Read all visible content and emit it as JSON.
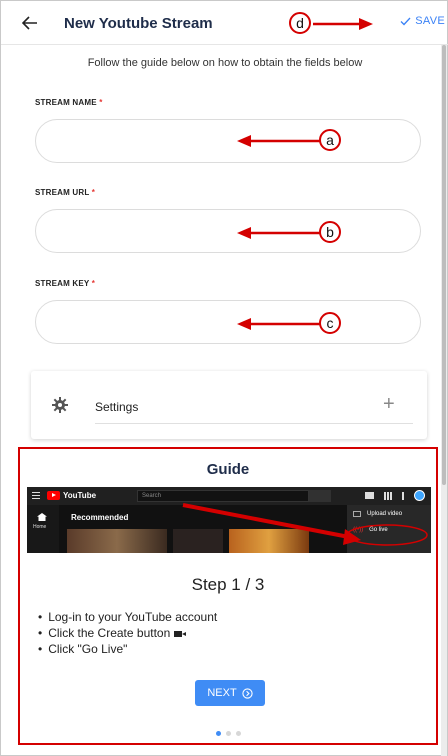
{
  "header": {
    "title": "New Youtube Stream",
    "save_label": "SAVE"
  },
  "intro": "Follow the guide below on how to obtain the fields below",
  "fields": [
    {
      "label": "STREAM NAME",
      "required_mark": "*",
      "value": "",
      "annotation": "a"
    },
    {
      "label": "STREAM URL",
      "required_mark": "*",
      "value": "",
      "annotation": "b"
    },
    {
      "label": "STREAM KEY",
      "required_mark": "*",
      "value": "",
      "annotation": "c"
    }
  ],
  "save_annotation": "d",
  "settings": {
    "label": "Settings",
    "expand_symbol": "+"
  },
  "guide": {
    "title": "Guide",
    "screenshot": {
      "search_placeholder": "Search",
      "logo_text": "YouTube",
      "home_label": "Home",
      "recommended": "Recommended",
      "menu_upload": "Upload video",
      "menu_go_live": "Go live"
    },
    "step": "Step 1 / 3",
    "bullets": [
      "Log-in to your YouTube account",
      "Click the Create button",
      "Click \"Go Live\""
    ],
    "next_label": "NEXT",
    "pager": {
      "current": 1,
      "total": 3
    }
  },
  "colors": {
    "accent": "#3f8cf5",
    "title": "#1f2d4a",
    "annotation": "#d40000",
    "required": "#e53935"
  }
}
